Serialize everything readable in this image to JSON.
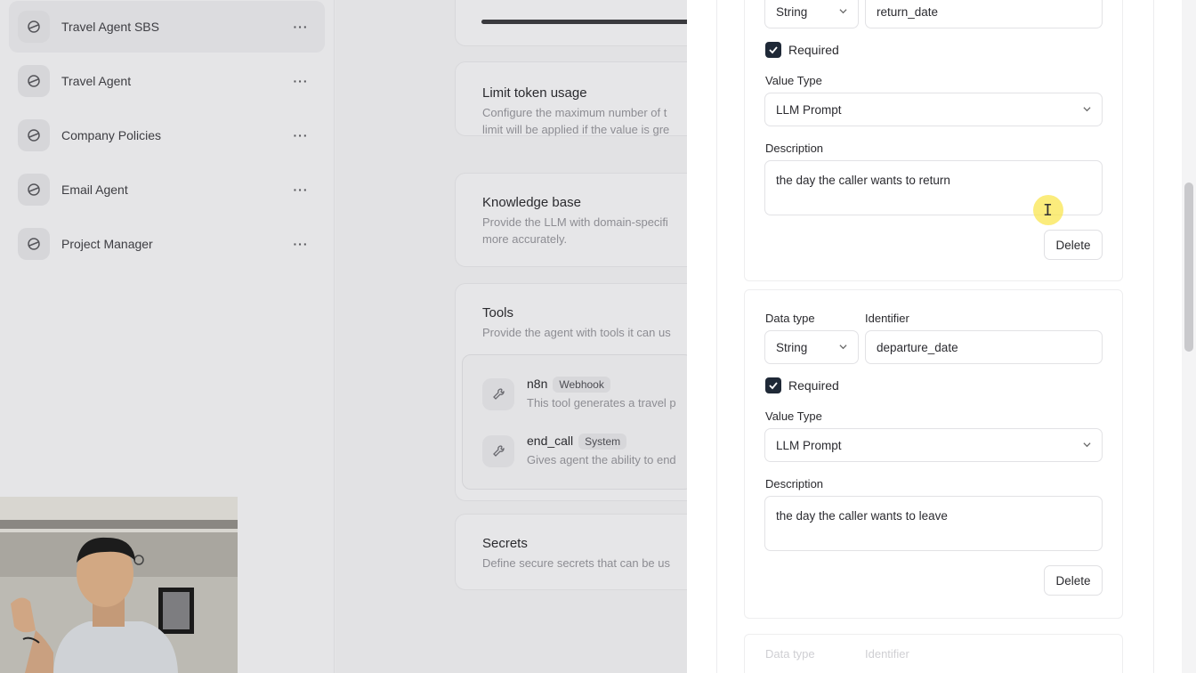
{
  "sidebar": {
    "agents": [
      {
        "label": "Travel Agent SBS",
        "more": "···"
      },
      {
        "label": "Travel Agent",
        "more": "···"
      },
      {
        "label": "Company Policies",
        "more": "···"
      },
      {
        "label": "Email Agent",
        "more": "···"
      },
      {
        "label": "Project Manager",
        "more": "···"
      }
    ]
  },
  "settings": {
    "progress_fraction": 1.0,
    "limit": {
      "title": "Limit token usage",
      "desc_1": "Configure the maximum number of t",
      "desc_2": "limit will be applied if the value is gre"
    },
    "knowledge": {
      "title": "Knowledge base",
      "desc_1": "Provide the LLM with domain-specifi",
      "desc_2": "more accurately."
    },
    "tools": {
      "title": "Tools",
      "desc": "Provide the agent with tools it can us",
      "items": [
        {
          "name": "n8n",
          "badge": "Webhook",
          "desc": "This tool generates a travel p"
        },
        {
          "name": "end_call",
          "badge": "System",
          "desc": "Gives agent the ability to end"
        }
      ]
    },
    "secrets": {
      "title": "Secrets",
      "desc": "Define secure secrets that can be us"
    }
  },
  "panel": {
    "params": [
      {
        "data_type": "String",
        "identifier": "return_date",
        "required_label": "Required",
        "value_type_label": "Value Type",
        "value_type": "LLM Prompt",
        "description_label": "Description",
        "description": "the day the caller wants to return",
        "delete_label": "Delete"
      },
      {
        "data_type_label": "Data type",
        "identifier_label": "Identifier",
        "data_type": "String",
        "identifier": "departure_date",
        "required_label": "Required",
        "value_type_label": "Value Type",
        "value_type": "LLM Prompt",
        "description_label": "Description",
        "description": "the day the caller wants to leave",
        "delete_label": "Delete"
      }
    ],
    "next_labels": {
      "data_type": "Data type",
      "identifier": "Identifier"
    }
  },
  "icons": {
    "agent": "agent-icon",
    "tool": "wrench-icon",
    "check": "check-icon",
    "chevron": "chevron-down-icon"
  },
  "colors": {
    "checkbox": "#1f2937",
    "cursor_highlight": "#fae650"
  }
}
